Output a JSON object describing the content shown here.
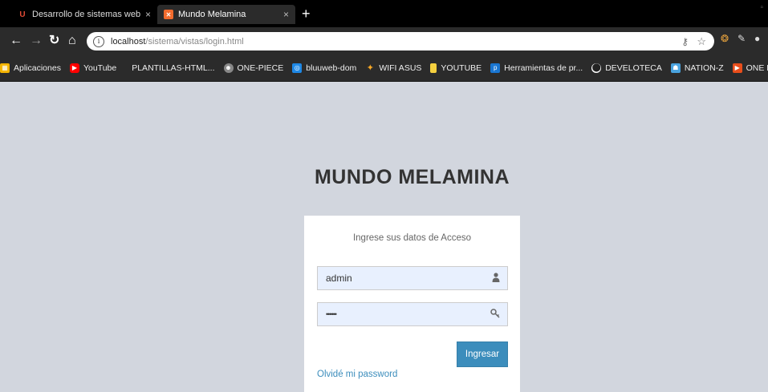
{
  "tabs": [
    {
      "title": "Desarrollo de sistemas web en PH",
      "close": "×",
      "icon": "udemy-icon",
      "active": false
    },
    {
      "title": "Mundo Melamina",
      "close": "×",
      "icon": "xampp-icon",
      "active": true
    }
  ],
  "new_tab": "+",
  "url": {
    "host": "localhost",
    "path": "/sistema/vistas/login.html"
  },
  "bookmarks": [
    {
      "label": "Aplicaciones",
      "icon": "apps-grid-icon",
      "color": "#f4b400"
    },
    {
      "label": "YouTube",
      "icon": "youtube-icon",
      "color": "#ff0000"
    },
    {
      "label": "PLANTILLAS-HTML...",
      "icon": "",
      "color": ""
    },
    {
      "label": "ONE-PIECE",
      "icon": "one-piece-icon",
      "color": "#888888"
    },
    {
      "label": "bluuweb-dom",
      "icon": "bluuweb-icon",
      "color": "#1e88e5"
    },
    {
      "label": "WIFI ASUS",
      "icon": "wifi-icon",
      "color": "#f9a825"
    },
    {
      "label": "YOUTUBE",
      "icon": "folder-icon",
      "color": "#f4d03f"
    },
    {
      "label": "Herramientas de pr...",
      "icon": "tools-icon",
      "color": "#1976d2"
    },
    {
      "label": "DEVELOTECA",
      "icon": "develoteca-icon",
      "color": "#444444"
    },
    {
      "label": "NATION-Z",
      "icon": "nation-z-icon",
      "color": "#4aa3df"
    },
    {
      "label": "ONE PIECE",
      "icon": "play-icon",
      "color": "#e94e1b"
    }
  ],
  "login": {
    "brand": "MUNDO MELAMINA",
    "message": "Ingrese sus datos de Acceso",
    "username": "admin",
    "password_mask": "••••••",
    "submit": "Ingresar",
    "forgot": "Olvidé mi password"
  },
  "colors": {
    "primary": "#3c8dbc",
    "page_bg": "#d2d6de",
    "input_bg": "#e8f0fe"
  }
}
